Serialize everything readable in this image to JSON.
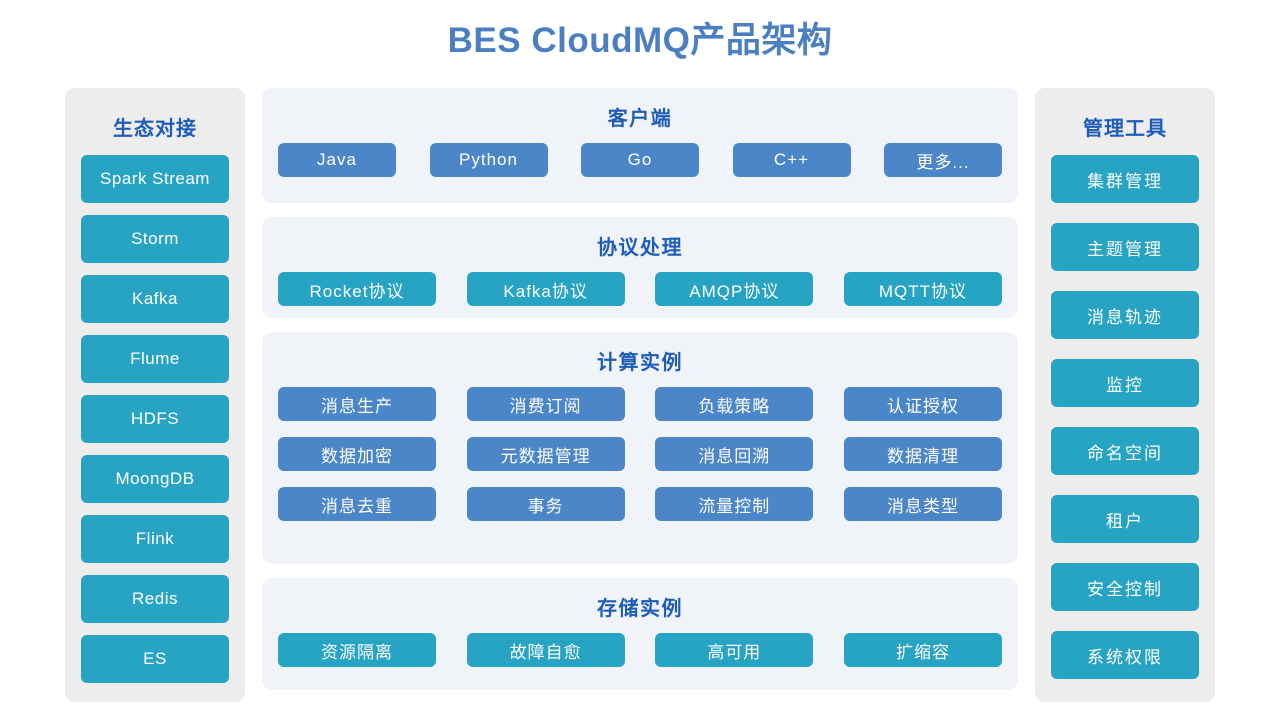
{
  "page": {
    "title": "BES CloudMQ产品架构"
  },
  "colors": {
    "title_blue": "#4a7fc1",
    "heading_blue": "#1d5cb8",
    "chip_blue": "#4b86c9",
    "chip_teal": "#27a3c3",
    "section_bg": "#f0f3f8",
    "side_bg": "#ededed",
    "page_bg": "#ffffff"
  },
  "left_panel": {
    "title": "生态对接",
    "items": [
      {
        "label": "Spark Stream"
      },
      {
        "label": "Storm"
      },
      {
        "label": "Kafka"
      },
      {
        "label": "Flume"
      },
      {
        "label": "HDFS"
      },
      {
        "label": "MoongDB"
      },
      {
        "label": "Flink"
      },
      {
        "label": "Redis"
      },
      {
        "label": "ES"
      }
    ]
  },
  "right_panel": {
    "title": "管理工具",
    "items": [
      {
        "label": "集群管理"
      },
      {
        "label": "主题管理"
      },
      {
        "label": "消息轨迹"
      },
      {
        "label": "监控"
      },
      {
        "label": "命名空间"
      },
      {
        "label": "租户"
      },
      {
        "label": "安全控制"
      },
      {
        "label": "系统权限"
      }
    ]
  },
  "sections": [
    {
      "id": "client",
      "title": "客户端",
      "style": "blue",
      "rows": [
        [
          {
            "label": "Java"
          },
          {
            "label": "Python"
          },
          {
            "label": "Go"
          },
          {
            "label": "C++"
          },
          {
            "label": "更多..."
          }
        ]
      ]
    },
    {
      "id": "protocol",
      "title": "协议处理",
      "style": "teal",
      "rows": [
        [
          {
            "label": "Rocket协议"
          },
          {
            "label": "Kafka协议"
          },
          {
            "label": "AMQP协议"
          },
          {
            "label": "MQTT协议"
          }
        ]
      ]
    },
    {
      "id": "compute",
      "title": "计算实例",
      "style": "blue",
      "rows": [
        [
          {
            "label": "消息生产"
          },
          {
            "label": "消费订阅"
          },
          {
            "label": "负载策略"
          },
          {
            "label": "认证授权"
          }
        ],
        [
          {
            "label": "数据加密"
          },
          {
            "label": "元数据管理"
          },
          {
            "label": "消息回溯"
          },
          {
            "label": "数据清理"
          }
        ],
        [
          {
            "label": "消息去重"
          },
          {
            "label": "事务"
          },
          {
            "label": "流量控制"
          },
          {
            "label": "消息类型"
          }
        ]
      ]
    },
    {
      "id": "storage",
      "title": "存储实例",
      "style": "teal",
      "rows": [
        [
          {
            "label": "资源隔离"
          },
          {
            "label": "故障自愈"
          },
          {
            "label": "高可用"
          },
          {
            "label": "扩缩容"
          }
        ]
      ]
    }
  ]
}
